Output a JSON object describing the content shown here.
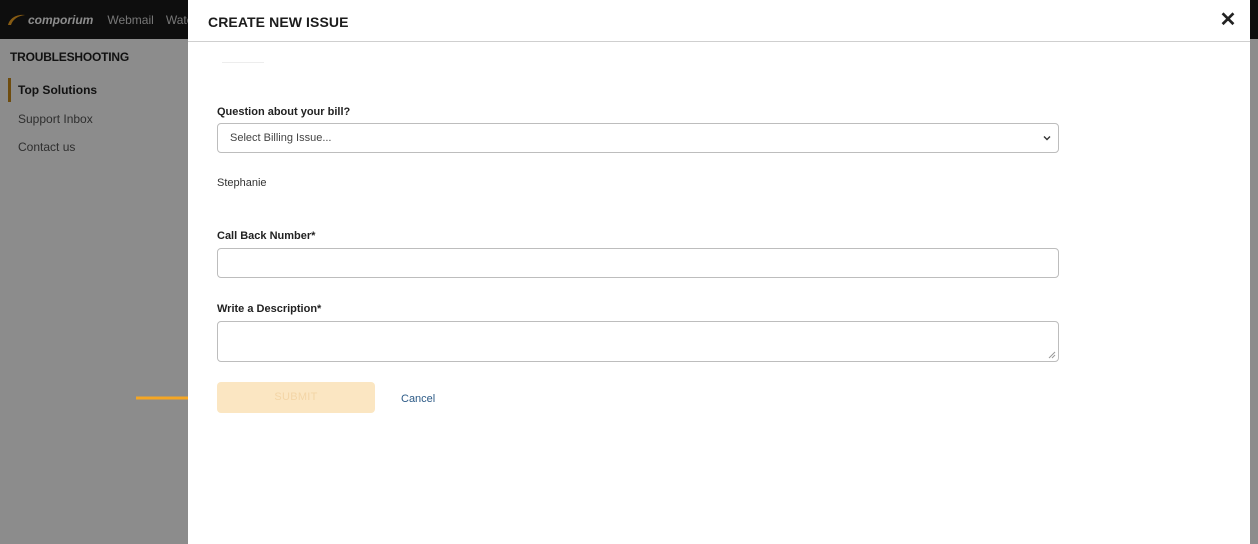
{
  "topbar": {
    "brand": "comporium",
    "nav": [
      "Webmail",
      "Watch"
    ]
  },
  "sidebar": {
    "title": "TROUBLESHOOTING",
    "items": [
      {
        "label": "Top Solutions",
        "active": true
      },
      {
        "label": "Support Inbox",
        "active": false
      },
      {
        "label": "Contact us",
        "active": false
      }
    ]
  },
  "modal": {
    "title": "CREATE NEW ISSUE",
    "close_icon": "close-icon",
    "billing": {
      "label": "Question about your bill?",
      "selected": "Select Billing Issue..."
    },
    "name_value": "Stephanie",
    "callback": {
      "label": "Call Back Number*",
      "value": ""
    },
    "description": {
      "label": "Write a Description*",
      "value": ""
    },
    "submit_label": "SUBMIT",
    "cancel_label": "Cancel"
  },
  "colors": {
    "accent": "#f5a623",
    "submit_bg": "#fbe6c2",
    "link": "#2d5b87"
  }
}
